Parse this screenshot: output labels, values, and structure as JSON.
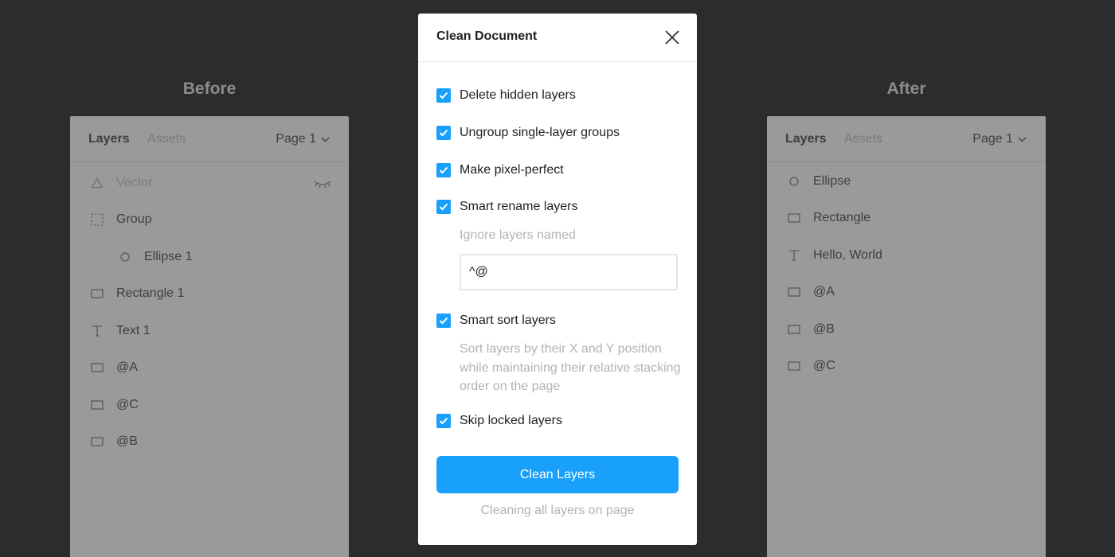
{
  "colors": {
    "backdrop": "#2c2c2c",
    "accent": "#18a0fb",
    "panel_dimmed": "#9a9a9a"
  },
  "before": {
    "heading": "Before",
    "tabs": {
      "layers": "Layers",
      "assets": "Assets"
    },
    "page_select": "Page 1",
    "layers": [
      {
        "label": "Vector",
        "icon": "vector-icon",
        "hidden": true
      },
      {
        "label": "Group",
        "icon": "frame-icon"
      },
      {
        "label": "Ellipse 1",
        "icon": "ellipse-icon",
        "indent": 1
      },
      {
        "label": "Rectangle 1",
        "icon": "rectangle-icon"
      },
      {
        "label": "Text 1",
        "icon": "text-icon"
      },
      {
        "label": "@A",
        "icon": "rectangle-icon"
      },
      {
        "label": "@C",
        "icon": "rectangle-icon"
      },
      {
        "label": "@B",
        "icon": "rectangle-icon"
      }
    ]
  },
  "after": {
    "heading": "After",
    "tabs": {
      "layers": "Layers",
      "assets": "Assets"
    },
    "page_select": "Page 1",
    "layers": [
      {
        "label": "Ellipse",
        "icon": "ellipse-icon"
      },
      {
        "label": "Rectangle",
        "icon": "rectangle-icon"
      },
      {
        "label": "Hello, World",
        "icon": "text-icon"
      },
      {
        "label": "@A",
        "icon": "rectangle-icon"
      },
      {
        "label": "@B",
        "icon": "rectangle-icon"
      },
      {
        "label": "@C",
        "icon": "rectangle-icon"
      }
    ]
  },
  "modal": {
    "title": "Clean Document",
    "options": {
      "delete_hidden": {
        "label": "Delete hidden layers",
        "checked": true
      },
      "ungroup_single": {
        "label": "Ungroup single-layer groups",
        "checked": true
      },
      "pixel_perfect": {
        "label": "Make pixel-perfect",
        "checked": true
      },
      "smart_rename": {
        "label": "Smart rename layers",
        "checked": true
      },
      "smart_sort": {
        "label": "Smart sort layers",
        "checked": true
      },
      "skip_locked": {
        "label": "Skip locked layers",
        "checked": true
      }
    },
    "ignore_label": "Ignore layers named",
    "ignore_value": "^@",
    "sort_description": "Sort layers by their X and Y position while maintaining their relative stacking order on the page",
    "primary_button": "Clean Layers",
    "footer_note": "Cleaning all layers on page"
  }
}
